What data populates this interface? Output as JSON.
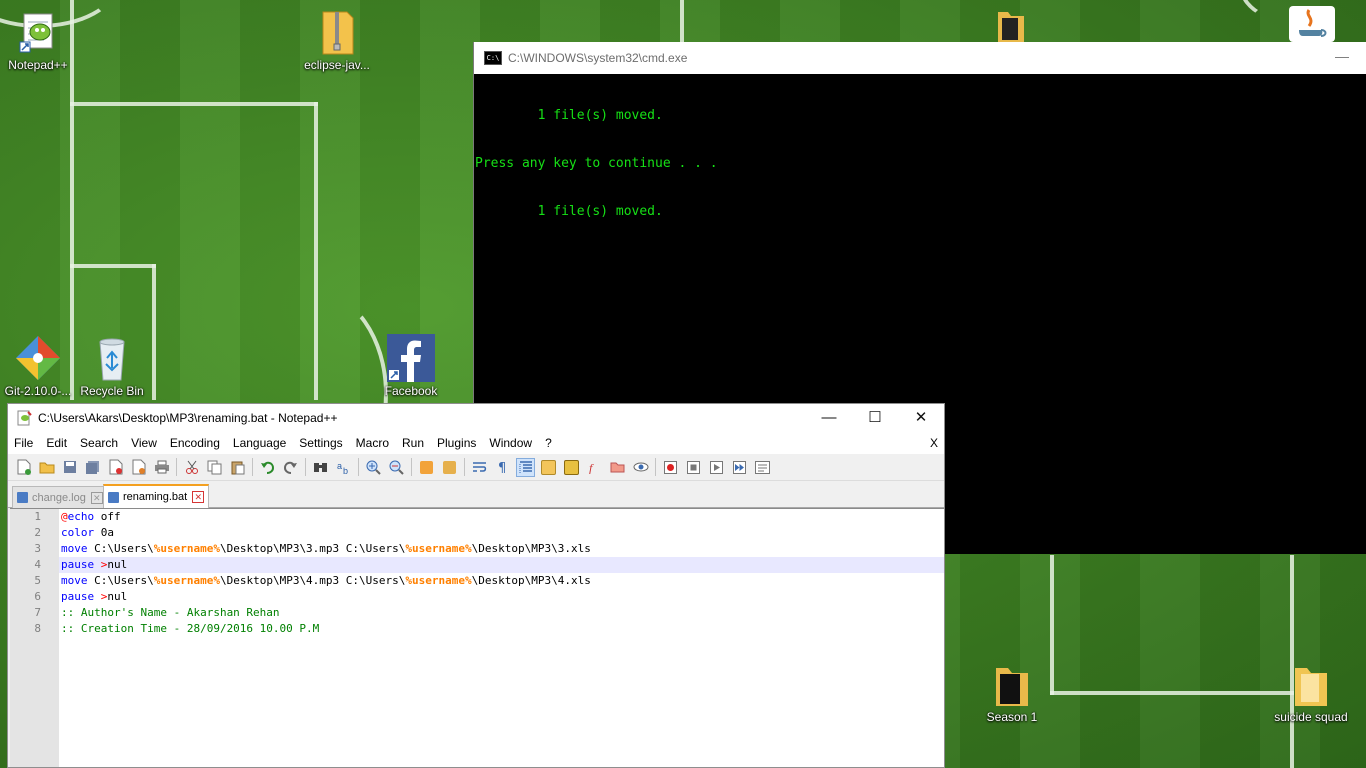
{
  "desktop": {
    "icons": [
      {
        "label": "Notepad++"
      },
      {
        "label": "eclipse-jav..."
      },
      {
        "label": "Git-2.10.0-..."
      },
      {
        "label": "Recycle Bin"
      },
      {
        "label": "Facebook"
      },
      {
        "label": "Season 1"
      },
      {
        "label": "suicide squad"
      }
    ]
  },
  "cmd": {
    "title": "C:\\WINDOWS\\system32\\cmd.exe",
    "min_glyph": "—",
    "output": [
      "        1 file(s) moved.",
      "Press any key to continue . . .",
      "        1 file(s) moved."
    ]
  },
  "notepad": {
    "title": "C:\\Users\\Akars\\Desktop\\MP3\\renaming.bat - Notepad++",
    "buttons": {
      "minimize": "—",
      "maximize": "☐",
      "close": "✕"
    },
    "menu": [
      "File",
      "Edit",
      "Search",
      "View",
      "Encoding",
      "Language",
      "Settings",
      "Macro",
      "Run",
      "Plugins",
      "Window",
      "?"
    ],
    "menu_close": "X",
    "tabs": [
      {
        "label": "change.log",
        "active": false
      },
      {
        "label": "renaming.bat",
        "active": true
      }
    ],
    "tab_close_glyph": "✕",
    "line_numbers": [
      "1",
      "2",
      "3",
      "4",
      "5",
      "6",
      "7",
      "8"
    ],
    "current_line": 4,
    "code": [
      {
        "at": "@",
        "kw": "echo",
        "rest": " off"
      },
      {
        "kw": "color",
        "rest": " 0a"
      },
      {
        "kw": "move",
        "p1": " C:\\Users\\",
        "v1": "%username%",
        "p2": "\\Desktop\\MP3\\3.mp3 C:\\Users\\",
        "v2": "%username%",
        "p3": "\\Desktop\\MP3\\3.xls"
      },
      {
        "kw": "pause",
        "op": " >",
        "rest": "nul"
      },
      {
        "kw": "move",
        "p1": " C:\\Users\\",
        "v1": "%username%",
        "p2": "\\Desktop\\MP3\\4.mp3 C:\\Users\\",
        "v2": "%username%",
        "p3": "\\Desktop\\MP3\\4.xls"
      },
      {
        "kw": "pause",
        "op": " >",
        "rest": "nul"
      },
      {
        "comment": ":: Author's Name - Akarshan Rehan"
      },
      {
        "comment": ":: Creation Time - 28/09/2016 10.00 P.M"
      }
    ]
  },
  "colors": {
    "console_text": "#16e016",
    "keyword": "#0000ff",
    "variable": "#ff8000",
    "comment": "#008000",
    "active_tab_accent": "#f4a020"
  }
}
